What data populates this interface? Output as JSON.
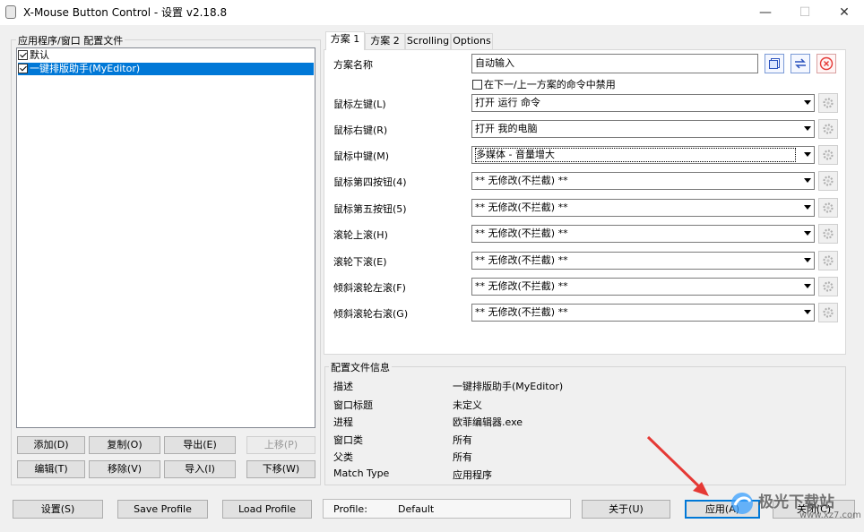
{
  "window": {
    "title": "X-Mouse Button Control - 设置 v2.18.8",
    "minimize_glyph": "—",
    "maximize_glyph": "☐",
    "close_glyph": "✕"
  },
  "profiles": {
    "group_label": "应用程序/窗口 配置文件",
    "items": [
      {
        "label": "默认",
        "checked": true,
        "selected": false
      },
      {
        "label": "一键排版助手(MyEditor)",
        "checked": true,
        "selected": true
      }
    ],
    "buttons": {
      "add": "添加(D)",
      "copy": "复制(O)",
      "export": "导出(E)",
      "move_up": "上移(P)",
      "edit": "编辑(T)",
      "remove": "移除(V)",
      "import": "导入(I)",
      "move_down": "下移(W)"
    }
  },
  "tabs": [
    "方案 1",
    "方案 2",
    "Scrolling",
    "Options"
  ],
  "scheme": {
    "name_label": "方案名称",
    "name_value": "自动输入",
    "disable_cycle_label": "在下一/上一方案的命令中禁用",
    "rows": [
      {
        "label": "鼠标左键(L)",
        "value": "打开 运行 命令"
      },
      {
        "label": "鼠标右键(R)",
        "value": "打开 我的电脑"
      },
      {
        "label": "鼠标中键(M)",
        "value": "多媒体 - 音量增大"
      },
      {
        "label": "鼠标第四按钮(4)",
        "value": "** 无修改(不拦截) **"
      },
      {
        "label": "鼠标第五按钮(5)",
        "value": "** 无修改(不拦截) **"
      },
      {
        "label": "滚轮上滚(H)",
        "value": "** 无修改(不拦截) **"
      },
      {
        "label": "滚轮下滚(E)",
        "value": "** 无修改(不拦截) **"
      },
      {
        "label": "倾斜滚轮左滚(F)",
        "value": "** 无修改(不拦截) **"
      },
      {
        "label": "倾斜滚轮右滚(G)",
        "value": "** 无修改(不拦截) **"
      }
    ]
  },
  "profile_info": {
    "group_label": "配置文件信息",
    "rows": [
      {
        "label": "描述",
        "value": "一键排版助手(MyEditor)"
      },
      {
        "label": "窗口标题",
        "value": "未定义"
      },
      {
        "label": "进程",
        "value": "欧菲编辑器.exe"
      },
      {
        "label": "窗口类",
        "value": "所有"
      },
      {
        "label": "父类",
        "value": "所有"
      },
      {
        "label": "Match Type",
        "value": "应用程序"
      }
    ]
  },
  "footer": {
    "settings": "设置(S)",
    "save_profile": "Save Profile",
    "load_profile": "Load Profile",
    "status_label": "Profile:",
    "status_value": "Default",
    "about": "关于(U)",
    "apply": "应用(A)",
    "close": "关闭(C)"
  },
  "watermark": {
    "title": "极光下载站",
    "url": "www.xz7.com"
  },
  "colors": {
    "selection": "#0078d7",
    "arrow": "#e53935",
    "remove_icon": "#e53935"
  }
}
